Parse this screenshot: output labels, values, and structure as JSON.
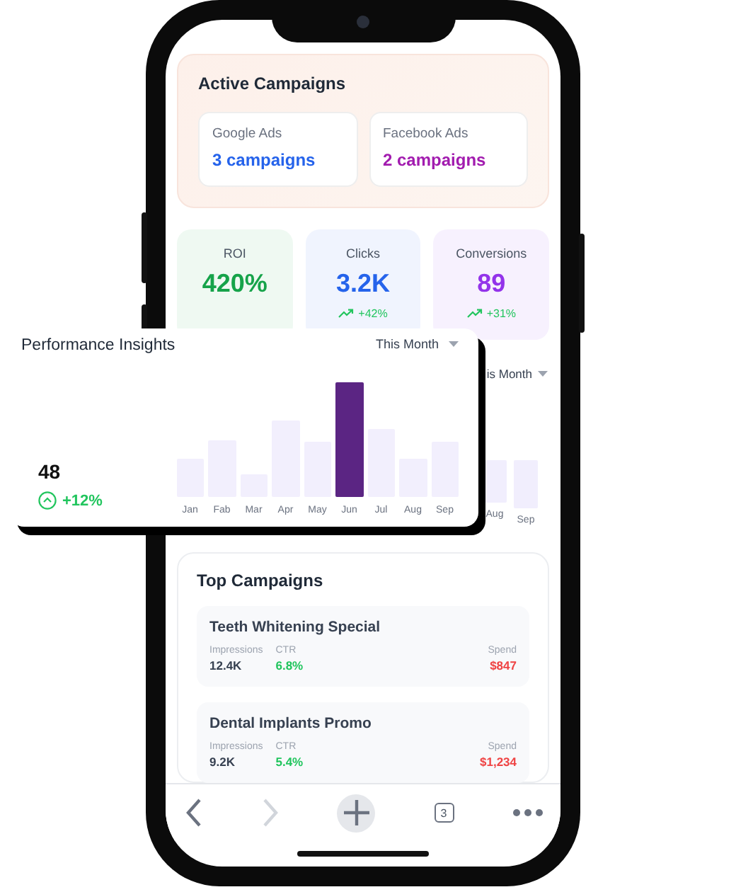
{
  "active_campaigns": {
    "title": "Active Campaigns",
    "platforms": [
      {
        "name": "Google Ads",
        "count": "3 campaigns",
        "color": "#2563eb"
      },
      {
        "name": "Facebook Ads",
        "count": "2 campaigns",
        "color": "#a21caf"
      }
    ]
  },
  "stats": [
    {
      "label": "ROI",
      "value": "420%",
      "color": "#16a34a"
    },
    {
      "label": "Clicks",
      "value": "3.2K",
      "trend": "+42%",
      "color": "#2563eb"
    },
    {
      "label": "Conversions",
      "value": "89",
      "trend": "+31%",
      "color": "#9333ea"
    }
  ],
  "background_chart": {
    "filter": "is Month",
    "labels": [
      "Aug",
      "Sep"
    ]
  },
  "top_campaigns": {
    "title": "Top Campaigns",
    "items": [
      {
        "name": "Teeth Whitening Special",
        "impressions_label": "Impressions",
        "impressions": "12.4K",
        "ctr_label": "CTR",
        "ctr": "6.8%",
        "spend_label": "Spend",
        "spend": "$847"
      },
      {
        "name": "Dental Implants Promo",
        "impressions_label": "Impressions",
        "impressions": "9.2K",
        "ctr_label": "CTR",
        "ctr": "5.4%",
        "spend_label": "Spend",
        "spend": "$1,234"
      }
    ]
  },
  "toolbar": [
    {
      "kind": "back",
      "disabled": false
    },
    {
      "kind": "forward",
      "disabled": true
    },
    {
      "kind": "new_tab"
    },
    {
      "kind": "tabs",
      "count": "3"
    },
    {
      "kind": "more"
    }
  ],
  "insights": {
    "title": "Performance Insights",
    "filter": "This Month",
    "value": "48",
    "change": "+12%",
    "months": [
      {
        "label": "Jan",
        "selected": false
      },
      {
        "label": "Fab",
        "selected": false
      },
      {
        "label": "Mar",
        "selected": false
      },
      {
        "label": "Apr",
        "selected": false
      },
      {
        "label": "May",
        "selected": false
      },
      {
        "label": "Jun",
        "selected": true
      },
      {
        "label": "Jul",
        "selected": false
      },
      {
        "label": "Aug",
        "selected": false
      },
      {
        "label": "Sep",
        "selected": false
      }
    ]
  }
}
